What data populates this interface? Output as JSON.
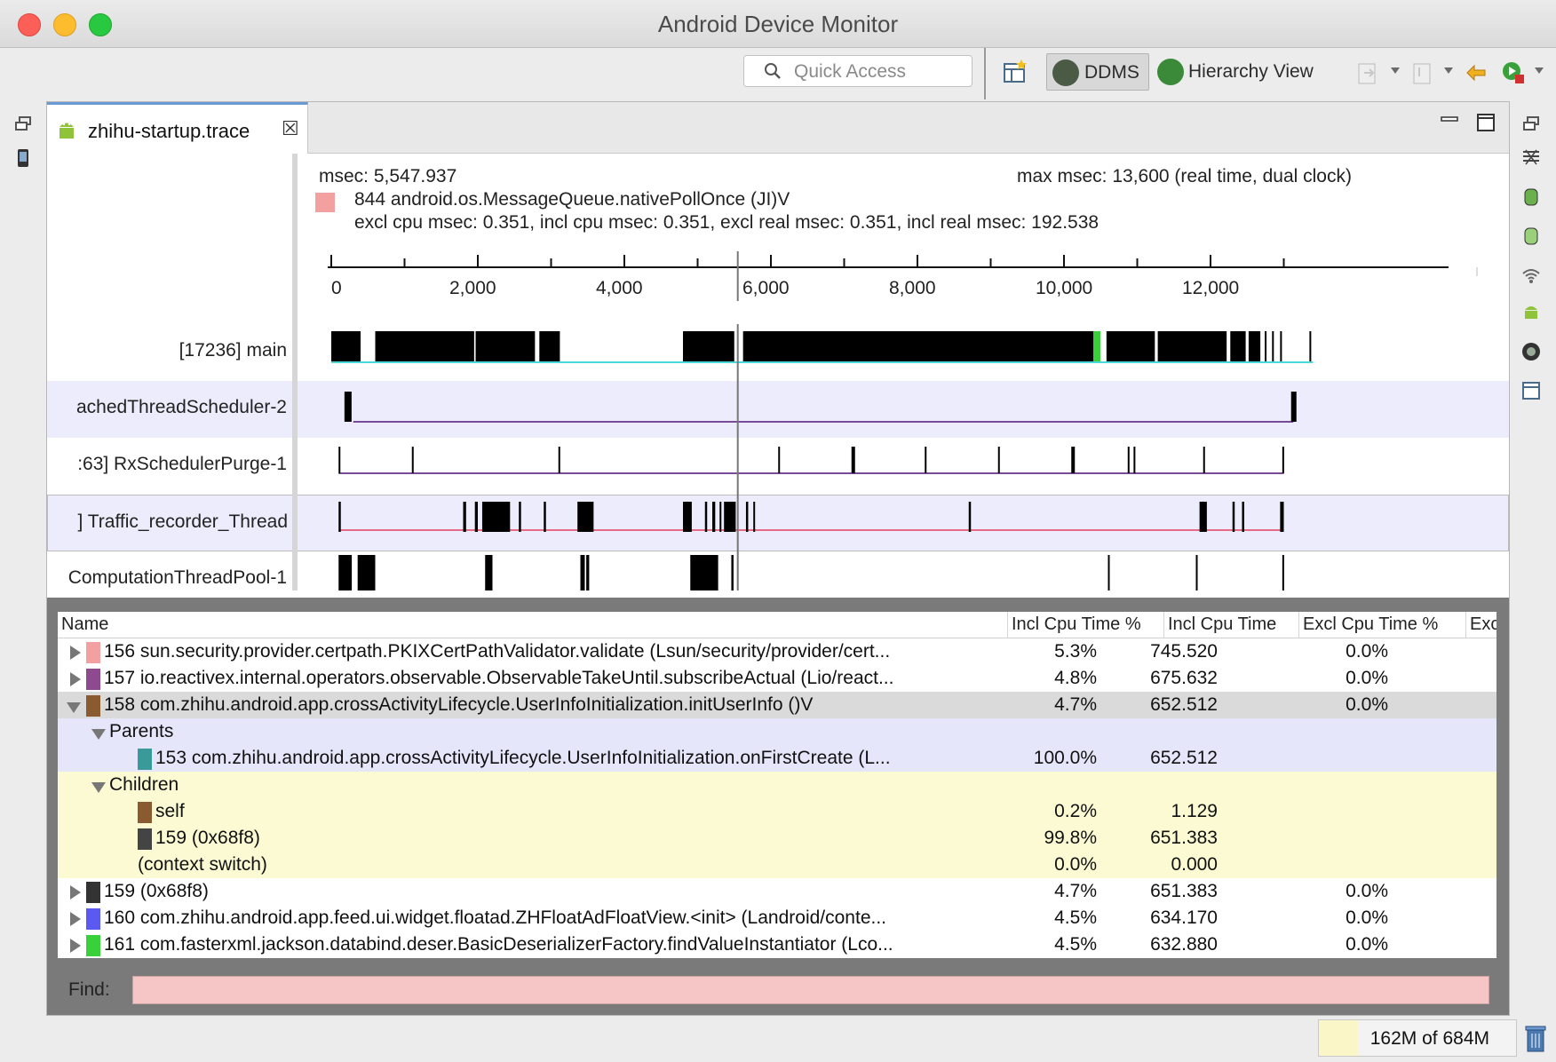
{
  "window": {
    "title": "Android Device Monitor"
  },
  "toolbar": {
    "quick_access_placeholder": "Quick Access",
    "perspectives": [
      {
        "label": "DDMS",
        "active": true,
        "icon": "ddms-icon"
      },
      {
        "label": "Hierarchy View",
        "active": false,
        "icon": "hierarchy-view-icon"
      }
    ]
  },
  "editor": {
    "tab_title": "zhihu-startup.trace"
  },
  "trace": {
    "msec": "msec: 5,547.937",
    "max_msec": "max msec: 13,600 (real time, dual clock)",
    "selected_method": "844 android.os.MessageQueue.nativePollOnce (JI)V",
    "selected_color": "#f2a0a0",
    "selected_stats": "excl cpu msec: 0.351, incl cpu msec: 0.351, excl real msec: 0.351, incl real msec: 192.538",
    "axis_ticks": [
      "0",
      "2,000",
      "4,000",
      "6,000",
      "8,000",
      "10,000",
      "12,000"
    ],
    "axis_max": 13600,
    "cursor_msec": 5547.937,
    "threads": [
      {
        "name": "[17236] main"
      },
      {
        "name": "achedThreadScheduler-2"
      },
      {
        "name": ":63] RxSchedulerPurge-1"
      },
      {
        "name": "] Traffic_recorder_Thread"
      },
      {
        "name": "ComputationThreadPool-1"
      }
    ]
  },
  "profile": {
    "columns": [
      "Name",
      "Incl Cpu Time %",
      "Incl Cpu Time",
      "Excl Cpu Time %",
      "Exc"
    ],
    "rows": [
      {
        "kind": "method",
        "expanded": false,
        "color": "#f2a0a0",
        "name": "156 sun.security.provider.certpath.PKIXCertPathValidator.validate (Lsun/security/provider/cert...",
        "incl_pct": "5.3%",
        "incl": "745.520",
        "excl_pct": "0.0%"
      },
      {
        "kind": "method",
        "expanded": false,
        "color": "#8e4a8e",
        "name": "157 io.reactivex.internal.operators.observable.ObservableTakeUntil.subscribeActual (Lio/react...",
        "incl_pct": "4.8%",
        "incl": "675.632",
        "excl_pct": "0.0%"
      },
      {
        "kind": "method-selected",
        "expanded": true,
        "color": "#8a5a30",
        "name": "158 com.zhihu.android.app.crossActivityLifecycle.UserInfoInitialization.initUserInfo ()V",
        "incl_pct": "4.7%",
        "incl": "652.512",
        "excl_pct": "0.0%"
      },
      {
        "kind": "group-parents",
        "name": "Parents"
      },
      {
        "kind": "parent",
        "color": "#3a9a9a",
        "name": "153 com.zhihu.android.app.crossActivityLifecycle.UserInfoInitialization.onFirstCreate (L...",
        "incl_pct": "100.0%",
        "incl": "652.512",
        "excl_pct": ""
      },
      {
        "kind": "group-children",
        "name": "Children"
      },
      {
        "kind": "child",
        "color": "#8a5a30",
        "name": "self",
        "incl_pct": "0.2%",
        "incl": "1.129",
        "excl_pct": ""
      },
      {
        "kind": "child",
        "color": "#444444",
        "name": "159 (0x68f8)",
        "incl_pct": "99.8%",
        "incl": "651.383",
        "excl_pct": ""
      },
      {
        "kind": "child-noswatch",
        "name": "(context switch)",
        "incl_pct": "0.0%",
        "incl": "0.000",
        "excl_pct": ""
      },
      {
        "kind": "method",
        "expanded": false,
        "color": "#333333",
        "name": "159 (0x68f8)",
        "incl_pct": "4.7%",
        "incl": "651.383",
        "excl_pct": "0.0%"
      },
      {
        "kind": "method",
        "expanded": false,
        "color": "#5a5af0",
        "name": "160 com.zhihu.android.app.feed.ui.widget.floatad.ZHFloatAdFloatView.<init> (Landroid/conte...",
        "incl_pct": "4.5%",
        "incl": "634.170",
        "excl_pct": "0.0%"
      },
      {
        "kind": "method",
        "expanded": false,
        "color": "#3ad03a",
        "name": "161 com.fasterxml.jackson.databind.deser.BasicDeserializerFactory.findValueInstantiator (Lco...",
        "incl_pct": "4.5%",
        "incl": "632.880",
        "excl_pct": "0.0%"
      }
    ],
    "find_label": "Find:",
    "find_value": ""
  },
  "status": {
    "heap": "162M of 684M"
  }
}
